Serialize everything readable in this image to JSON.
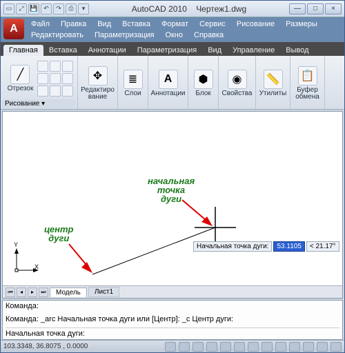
{
  "title": {
    "app": "AutoCAD 2010",
    "doc": "Чертеж1.dwg"
  },
  "winctl": {
    "min": "—",
    "max": "□",
    "close": "×"
  },
  "menu": [
    "Файл",
    "Правка",
    "Вид",
    "Вставка",
    "Формат",
    "Сервис",
    "Рисование",
    "Размеры",
    "Редактировать",
    "Параметризация",
    "Окно",
    "Справка"
  ],
  "tabs": [
    "Главная",
    "Вставка",
    "Аннотации",
    "Параметризация",
    "Вид",
    "Управление",
    "Вывод"
  ],
  "ribbon": {
    "draw": {
      "line": "Отрезок",
      "footer": "Рисование ▾"
    },
    "modify": "Редактиро\nвание",
    "layers": "Слои",
    "annot": "Аннотации",
    "block": "Блок",
    "props": "Свойства",
    "util": "Утилиты",
    "clip": "Буфер\nобмена"
  },
  "canvas": {
    "ucs_x": "X",
    "ucs_y": "Y",
    "label_start": "начальная\nточка\nдуги",
    "label_center": "центр\nдуги",
    "dyn_label": "Начальная точка дуги:",
    "dyn_val": "53.1105",
    "dyn_ang": "< 21.17°"
  },
  "layout_tabs": {
    "model": "Модель",
    "sheet": "Лист1"
  },
  "cmd": {
    "l1": "Команда:",
    "l2": "Команда: _arc Начальная точка дуги или [Центр]: _с Центр дуги:",
    "l3": "Начальная точка дуги:"
  },
  "status": {
    "coords": "103.3348, 36.8075 , 0.0000"
  }
}
